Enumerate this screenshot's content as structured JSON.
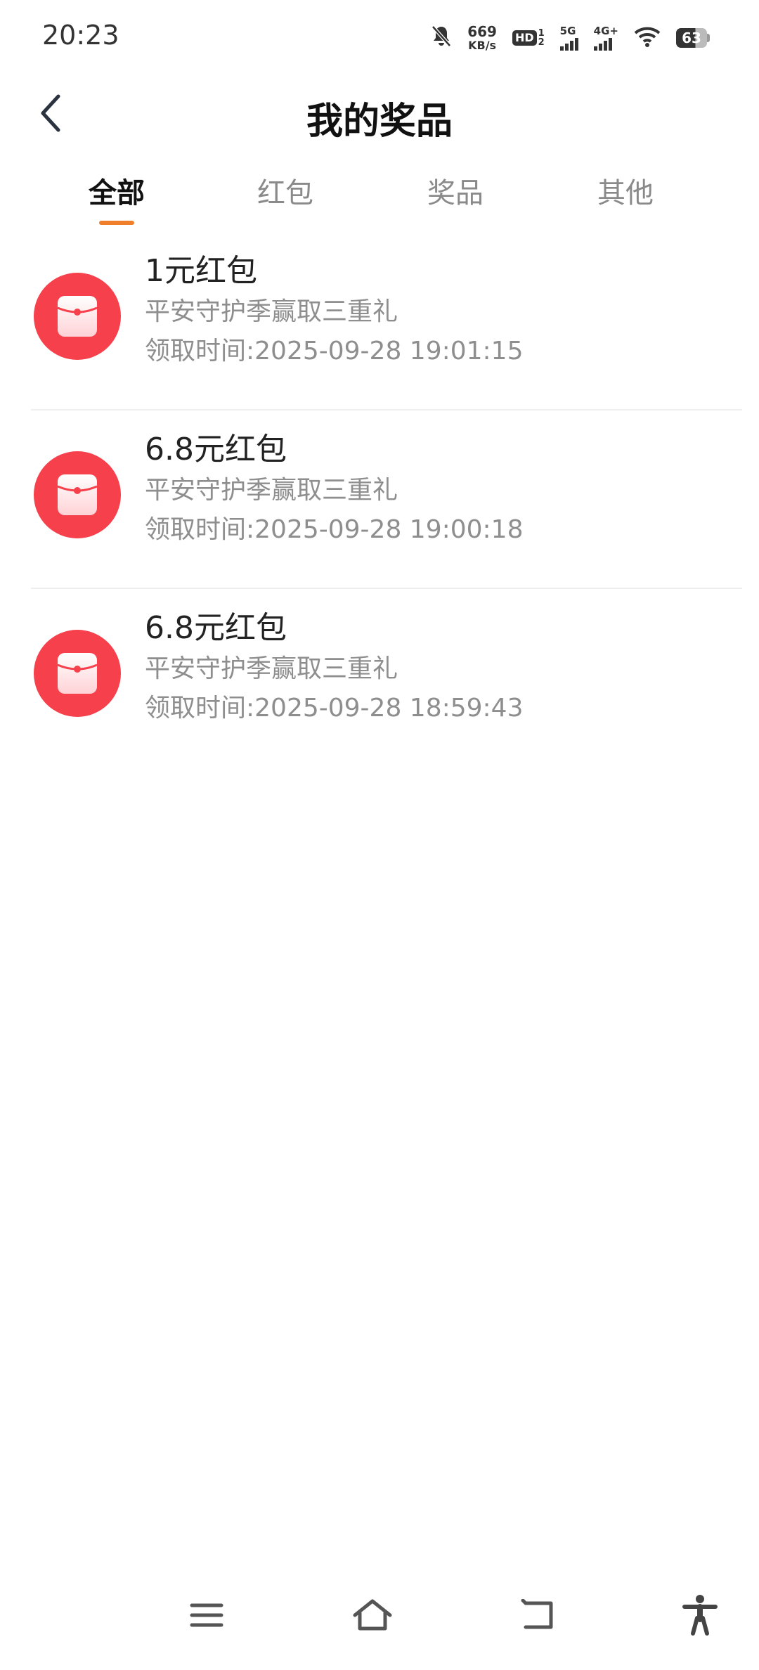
{
  "status_bar": {
    "time": "20:23",
    "net_speed_value": "669",
    "net_speed_unit": "KB/s",
    "hd_label": "HD",
    "hd_sub_top": "1",
    "hd_sub_bottom": "2",
    "signal1_label": "5G",
    "signal2_label": "4G+",
    "battery": "63",
    "icons": [
      "bell-muted-icon",
      "wifi-icon",
      "battery-icon"
    ]
  },
  "header": {
    "title": "我的奖品"
  },
  "tabs": [
    {
      "label": "全部",
      "active": true
    },
    {
      "label": "红包",
      "active": false
    },
    {
      "label": "奖品",
      "active": false
    },
    {
      "label": "其他",
      "active": false
    }
  ],
  "prizes": [
    {
      "name": "1元红包",
      "campaign": "平安守护季赢取三重礼",
      "time": "领取时间:2025-09-28 19:01:15",
      "icon": "red-envelope-icon"
    },
    {
      "name": "6.8元红包",
      "campaign": "平安守护季赢取三重礼",
      "time": "领取时间:2025-09-28 19:00:18",
      "icon": "red-envelope-icon"
    },
    {
      "name": "6.8元红包",
      "campaign": "平安守护季赢取三重礼",
      "time": "领取时间:2025-09-28 18:59:43",
      "icon": "red-envelope-icon"
    }
  ],
  "colors": {
    "accent": "#f07f2b",
    "envelope_red": "#f6404b",
    "secondary_text": "#8e8e8e"
  },
  "nav_bar": {
    "icons": [
      "menu-icon",
      "home-icon",
      "back-nav-icon",
      "accessibility-icon"
    ]
  }
}
